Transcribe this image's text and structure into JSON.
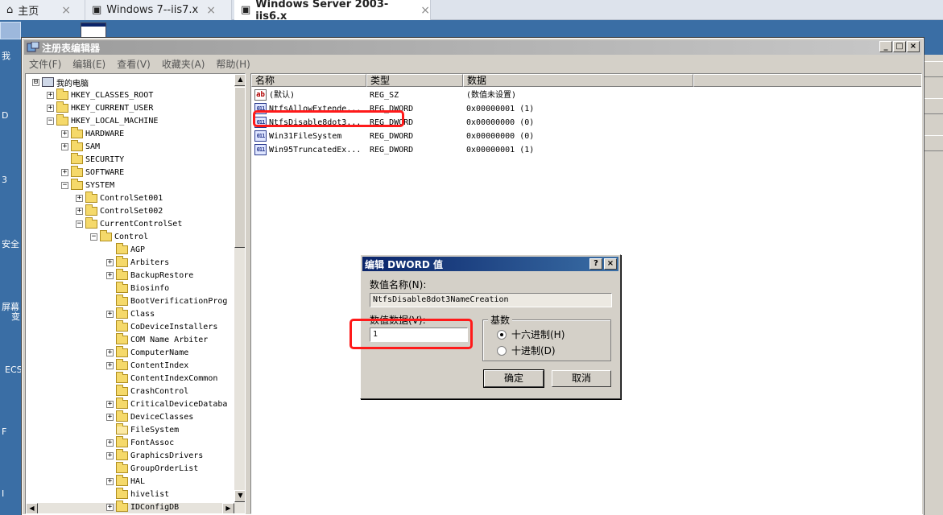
{
  "host_tabs": [
    {
      "label": "主页",
      "icon": "home-icon",
      "close": "×"
    },
    {
      "label": "Windows 7--iis7.x",
      "icon": "vm-icon",
      "close": "×"
    },
    {
      "label": "Windows Server 2003-iis6.x",
      "icon": "vm-icon",
      "close": "×"
    }
  ],
  "desktop_labels": [
    "我",
    "D",
    "3",
    "安全",
    "屏幕",
    "变",
    "ECS",
    "F",
    "I"
  ],
  "window": {
    "title": "注册表编辑器",
    "controls": [
      "_",
      "□",
      "×"
    ],
    "menu": [
      "文件(F)",
      "编辑(E)",
      "查看(V)",
      "收藏夹(A)",
      "帮助(H)"
    ]
  },
  "tree": [
    {
      "label": "我的电脑",
      "depth": 0,
      "expander": "⊟",
      "icon": "computer"
    },
    {
      "label": "HKEY_CLASSES_ROOT",
      "depth": 1,
      "expander": "+",
      "icon": "folder"
    },
    {
      "label": "HKEY_CURRENT_USER",
      "depth": 1,
      "expander": "+",
      "icon": "folder"
    },
    {
      "label": "HKEY_LOCAL_MACHINE",
      "depth": 1,
      "expander": "−",
      "icon": "folder"
    },
    {
      "label": "HARDWARE",
      "depth": 2,
      "expander": "+",
      "icon": "folder"
    },
    {
      "label": "SAM",
      "depth": 2,
      "expander": "+",
      "icon": "folder"
    },
    {
      "label": "SECURITY",
      "depth": 2,
      "expander": "",
      "icon": "folder"
    },
    {
      "label": "SOFTWARE",
      "depth": 2,
      "expander": "+",
      "icon": "folder"
    },
    {
      "label": "SYSTEM",
      "depth": 2,
      "expander": "−",
      "icon": "folder"
    },
    {
      "label": "ControlSet001",
      "depth": 3,
      "expander": "+",
      "icon": "folder"
    },
    {
      "label": "ControlSet002",
      "depth": 3,
      "expander": "+",
      "icon": "folder"
    },
    {
      "label": "CurrentControlSet",
      "depth": 3,
      "expander": "−",
      "icon": "folder"
    },
    {
      "label": "Control",
      "depth": 4,
      "expander": "−",
      "icon": "folder"
    },
    {
      "label": "AGP",
      "depth": 5,
      "expander": "",
      "icon": "folder"
    },
    {
      "label": "Arbiters",
      "depth": 5,
      "expander": "+",
      "icon": "folder"
    },
    {
      "label": "BackupRestore",
      "depth": 5,
      "expander": "+",
      "icon": "folder"
    },
    {
      "label": "Biosinfo",
      "depth": 5,
      "expander": "",
      "icon": "folder"
    },
    {
      "label": "BootVerificationProg",
      "depth": 5,
      "expander": "",
      "icon": "folder"
    },
    {
      "label": "Class",
      "depth": 5,
      "expander": "+",
      "icon": "folder"
    },
    {
      "label": "CoDeviceInstallers",
      "depth": 5,
      "expander": "",
      "icon": "folder"
    },
    {
      "label": "COM Name Arbiter",
      "depth": 5,
      "expander": "",
      "icon": "folder"
    },
    {
      "label": "ComputerName",
      "depth": 5,
      "expander": "+",
      "icon": "folder"
    },
    {
      "label": "ContentIndex",
      "depth": 5,
      "expander": "+",
      "icon": "folder"
    },
    {
      "label": "ContentIndexCommon",
      "depth": 5,
      "expander": "",
      "icon": "folder"
    },
    {
      "label": "CrashControl",
      "depth": 5,
      "expander": "",
      "icon": "folder"
    },
    {
      "label": "CriticalDeviceDataba",
      "depth": 5,
      "expander": "+",
      "icon": "folder"
    },
    {
      "label": "DeviceClasses",
      "depth": 5,
      "expander": "+",
      "icon": "folder"
    },
    {
      "label": "FileSystem",
      "depth": 5,
      "expander": "",
      "icon": "folder-open"
    },
    {
      "label": "FontAssoc",
      "depth": 5,
      "expander": "+",
      "icon": "folder"
    },
    {
      "label": "GraphicsDrivers",
      "depth": 5,
      "expander": "+",
      "icon": "folder"
    },
    {
      "label": "GroupOrderList",
      "depth": 5,
      "expander": "",
      "icon": "folder"
    },
    {
      "label": "HAL",
      "depth": 5,
      "expander": "+",
      "icon": "folder"
    },
    {
      "label": "hivelist",
      "depth": 5,
      "expander": "",
      "icon": "folder"
    },
    {
      "label": "IDConfigDB",
      "depth": 5,
      "expander": "+",
      "icon": "folder"
    }
  ],
  "list": {
    "columns": [
      "名称",
      "类型",
      "数据"
    ],
    "rows": [
      {
        "name": "(默认)",
        "type": "REG_SZ",
        "data": "(数值未设置)",
        "icon": "string-value-icon"
      },
      {
        "name": "NtfsAllowExtende...",
        "type": "REG_DWORD",
        "data": "0x00000001 (1)",
        "icon": "dword-value-icon"
      },
      {
        "name": "NtfsDisable8dot3...",
        "type": "REG_DWORD",
        "data": "0x00000000 (0)",
        "icon": "dword-value-icon"
      },
      {
        "name": "Win31FileSystem",
        "type": "REG_DWORD",
        "data": "0x00000000 (0)",
        "icon": "dword-value-icon"
      },
      {
        "name": "Win95TruncatedEx...",
        "type": "REG_DWORD",
        "data": "0x00000001 (1)",
        "icon": "dword-value-icon"
      }
    ]
  },
  "dialog": {
    "title": "编辑 DWORD 值",
    "help": "?",
    "close": "×",
    "name_label": "数值名称(N):",
    "name_value": "NtfsDisable8dot3NameCreation",
    "data_label": "数值数据(V):",
    "data_value": "1",
    "base_label": "基数",
    "hex_label": "十六进制(H)",
    "dec_label": "十进制(D)",
    "selected_base": "hex",
    "ok": "确定",
    "cancel": "取消"
  },
  "colors": {
    "highlight": "#ff1a1a",
    "dialog_title": "#0a246a",
    "desktop": "#3a6ea5"
  }
}
